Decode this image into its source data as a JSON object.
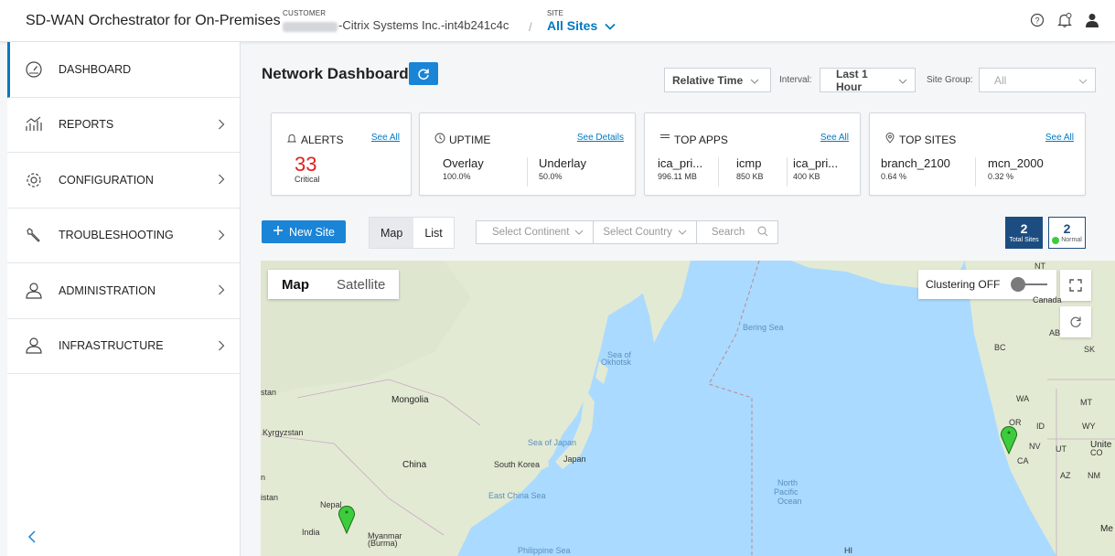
{
  "header": {
    "app_title": "SD-WAN Orchestrator for On-Premises",
    "customer_label": "CUSTOMER",
    "customer_value": "-Citrix Systems Inc.-int4b241c4c",
    "separator": "/",
    "site_label": "SITE",
    "site_value": "All Sites",
    "icons": [
      "help-icon",
      "notification-icon",
      "user-icon"
    ]
  },
  "sidebar": {
    "items": [
      {
        "label": "DASHBOARD",
        "icon": "dashboard-icon",
        "active": true
      },
      {
        "label": "REPORTS",
        "icon": "reports-icon"
      },
      {
        "label": "CONFIGURATION",
        "icon": "gear-icon"
      },
      {
        "label": "TROUBLESHOOTING",
        "icon": "wrench-icon"
      },
      {
        "label": "ADMINISTRATION",
        "icon": "user-icon"
      },
      {
        "label": "INFRASTRUCTURE",
        "icon": "user-icon"
      }
    ]
  },
  "dashboard": {
    "title": "Network Dashboard",
    "time_mode": "Relative Time",
    "interval_label": "Interval:",
    "interval_value": "Last 1 Hour",
    "site_group_label": "Site Group:",
    "site_group_value": "All"
  },
  "cards": {
    "alerts": {
      "title": "ALERTS",
      "link": "See All",
      "count": "33",
      "severity": "Critical",
      "count_color": "#e21d1d"
    },
    "uptime": {
      "title": "UPTIME",
      "link": "See Details",
      "metrics": [
        {
          "name": "Overlay",
          "value": "100.0%"
        },
        {
          "name": "Underlay",
          "value": "50.0%"
        }
      ]
    },
    "top_apps": {
      "title": "TOP APPS",
      "link": "See All",
      "metrics": [
        {
          "name": "ica_pri...",
          "value": "996.11 MB"
        },
        {
          "name": "icmp",
          "value": "850 KB"
        },
        {
          "name": "ica_pri...",
          "value": "400 KB"
        }
      ]
    },
    "top_sites": {
      "title": "TOP SITES",
      "link": "See All",
      "metrics": [
        {
          "name": "branch_2100",
          "value": "0.64 %"
        },
        {
          "name": "mcn_2000",
          "value": "0.32 %"
        }
      ]
    }
  },
  "toolbar": {
    "new_site": "New Site",
    "view_map": "Map",
    "view_list": "List",
    "continent_placeholder": "Select Continent",
    "country_placeholder": "Select Country",
    "search_placeholder": "Search",
    "total_sites_count": "2",
    "total_sites_label": "Total Sites",
    "normal_count": "2",
    "normal_label": "Normal"
  },
  "map": {
    "type_map": "Map",
    "type_satellite": "Satellite",
    "clustering_label": "Clustering OFF",
    "labels": {
      "mongolia": "Mongolia",
      "china": "China",
      "south_korea": "South Korea",
      "japan": "Japan",
      "sea_of_japan": "Sea of Japan",
      "sea_of_okhotsk_1": "Sea of",
      "sea_of_okhotsk_2": "Okhotsk",
      "bering_sea": "Bering Sea",
      "east_china_sea": "East China Sea",
      "philippine_sea": "Philippine Sea",
      "north_pacific_1": "North",
      "north_pacific_2": "Pacific",
      "north_pacific_3": "Ocean",
      "kyrgyzstan": "Kyrgyzstan",
      "stan": "stan",
      "istan": "istan",
      "n": "n",
      "nepal": "Nepal",
      "india": "India",
      "myanmar_1": "Myanmar",
      "myanmar_2": "(Burma)",
      "canada": "Canada",
      "nt": "NT",
      "ab": "AB",
      "bc": "BC",
      "sk": "SK",
      "wa": "WA",
      "mt": "MT",
      "or": "OR",
      "id": "ID",
      "wy": "WY",
      "nv": "NV",
      "ut": "UT",
      "united_1": "Unite",
      "co": "CO",
      "ca": "CA",
      "az": "AZ",
      "nm": "NM",
      "me": "Me",
      "hi": "HI"
    },
    "colors": {
      "water": "#aadaff",
      "land": "#e3ead3",
      "pin": "#3ccc3c"
    }
  }
}
